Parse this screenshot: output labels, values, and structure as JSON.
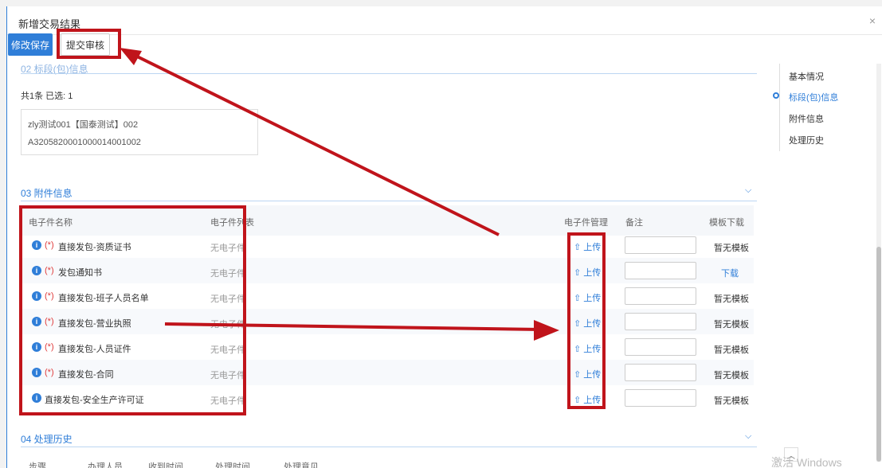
{
  "modal": {
    "title": "新增交易结果",
    "close": "×"
  },
  "toolbar": {
    "save_label": "修改保存",
    "submit_label": "提交审核"
  },
  "section_package": {
    "header": "02 标段(包)信息",
    "count_text": "共1条  已选: 1",
    "card_line1": "zly测试001【国泰测试】002",
    "card_line2": "A320582000100001400100​2"
  },
  "section_attachments": {
    "header": "03  附件信息",
    "columns": [
      "电子件名称",
      "电子件列表",
      "电子件管理",
      "备注",
      "模板下载"
    ],
    "rows": [
      {
        "required": "(*)",
        "name": "直接发包-资质证书",
        "files": "无电子件",
        "upload": "上传",
        "template": "暂无模板"
      },
      {
        "required": "(*)",
        "name": "发包通知书",
        "files": "无电子件",
        "upload": "上传",
        "template": "下载"
      },
      {
        "required": "(*)",
        "name": "直接发包-班子人员名单",
        "files": "无电子件",
        "upload": "上传",
        "template": "暂无模板"
      },
      {
        "required": "(*)",
        "name": "直接发包-营业执照",
        "files": "无电子件",
        "upload": "上传",
        "template": "暂无模板"
      },
      {
        "required": "(*)",
        "name": "直接发包-人员证件",
        "files": "无电子件",
        "upload": "上传",
        "template": "暂无模板"
      },
      {
        "required": "(*)",
        "name": "直接发包-合同",
        "files": "无电子件",
        "upload": "上传",
        "template": "暂无模板"
      },
      {
        "required": "",
        "name": "直接发包-安全生产许可证",
        "files": "无电子件",
        "upload": "上传",
        "template": "暂无模板"
      }
    ]
  },
  "section_history": {
    "header": "04  处理历史",
    "columns": [
      "步骤",
      "办理人员",
      "收到时间",
      "处理时间",
      "处理意见"
    ]
  },
  "right_nav": {
    "items": [
      "基本情况",
      "标段(包)信息",
      "附件信息",
      "处理历史"
    ],
    "active_index": 1
  },
  "os_watermark": "激活 Windows",
  "colors": {
    "accent": "#2f7ed8",
    "annotation_red": "#c0141b",
    "required_red": "#e03c3c"
  }
}
